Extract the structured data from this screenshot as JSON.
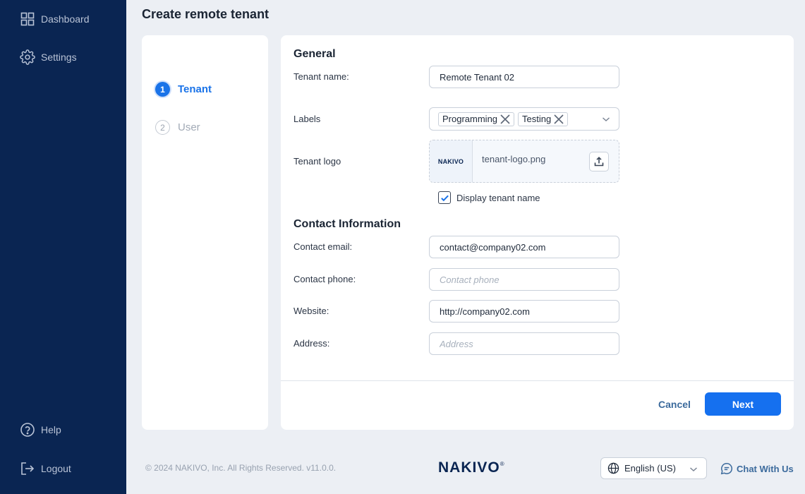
{
  "sidebar": {
    "items": [
      {
        "label": "Dashboard",
        "icon": "dashboard-grid-icon"
      },
      {
        "label": "Settings",
        "icon": "gear-icon"
      },
      {
        "label": "Help",
        "icon": "help-circle-icon"
      },
      {
        "label": "Logout",
        "icon": "logout-icon"
      }
    ]
  },
  "page": {
    "title": "Create remote tenant"
  },
  "stepper": {
    "steps": [
      {
        "number": "1",
        "label": "Tenant",
        "state": "active"
      },
      {
        "number": "2",
        "label": "User",
        "state": "inactive"
      }
    ]
  },
  "form": {
    "general_title": "General",
    "tenant_name": {
      "label": "Tenant name:",
      "value": "Remote Tenant 02"
    },
    "labels": {
      "label": "Labels",
      "chips": [
        "Programming",
        "Testing"
      ]
    },
    "tenant_logo": {
      "label": "Tenant logo",
      "thumbnail_text": "NAKIVO",
      "file_name": "tenant-logo.png"
    },
    "display_tenant_name": {
      "label": "Display tenant name",
      "checked": true
    },
    "contact_title": "Contact Information",
    "contact_email": {
      "label": "Contact email:",
      "value": "contact@company02.com"
    },
    "contact_phone": {
      "label": "Contact phone:",
      "value": "",
      "placeholder": "Contact phone"
    },
    "website": {
      "label": "Website:",
      "value": "http://company02.com"
    },
    "address": {
      "label": "Address:",
      "value": "",
      "placeholder": "Address"
    }
  },
  "actions": {
    "cancel_label": "Cancel",
    "next_label": "Next"
  },
  "footer": {
    "copyright": "© 2024 NAKIVO, Inc. All Rights Reserved. v11.0.0.",
    "brand": "NAKIVO",
    "brand_mark": "®",
    "language": "English (US)",
    "chat_label": "Chat With Us"
  },
  "colors": {
    "sidebar_bg": "#0a2552",
    "accent": "#1570ef",
    "page_bg": "#eceff4"
  }
}
